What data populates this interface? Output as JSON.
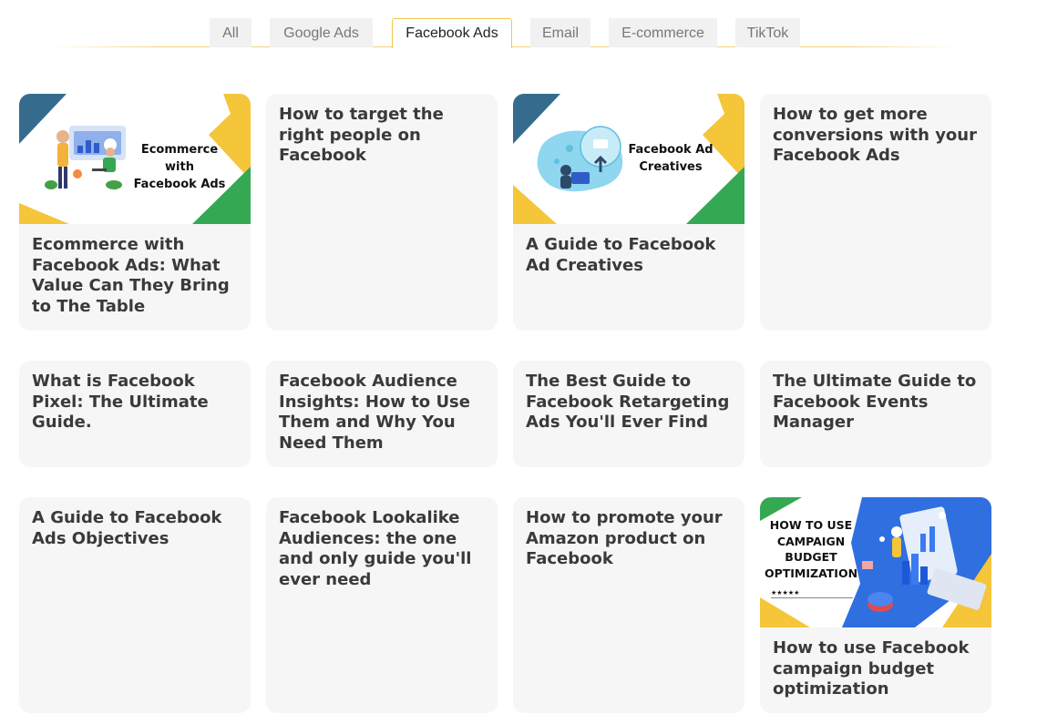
{
  "tabs": [
    {
      "label": "All"
    },
    {
      "label": "Google Ads"
    },
    {
      "label": "Facebook Ads",
      "active": true
    },
    {
      "label": "Email"
    },
    {
      "label": "E-commerce"
    },
    {
      "label": "TikTok"
    }
  ],
  "colors": {
    "accent": "#f0c64a",
    "card_bg": "#f6f6f6",
    "title_text": "#3a3a3a",
    "thumb_yellow": "#f5c53a",
    "thumb_green": "#34a853",
    "thumb_blue": "#356c8e"
  },
  "cards": [
    {
      "title": "Ecommerce with Facebook Ads: What Value Can They Bring to The Table",
      "thumbnail": {
        "line1": "Ecommerce with",
        "line2": "Facebook Ads",
        "illustration": "people-with-dashboard-illustration"
      }
    },
    {
      "title": "How to target the right people on Facebook"
    },
    {
      "title": "A Guide to Facebook Ad Creatives",
      "thumbnail": {
        "line1": "Facebook Ad",
        "line2": "Creatives",
        "illustration": "person-with-laptop-illustration"
      }
    },
    {
      "title": "How to get more conversions with your Facebook Ads"
    },
    {
      "title": "What is Facebook Pixel: The Ultimate Guide."
    },
    {
      "title": "Facebook Audience Insights: How to Use Them and Why You Need Them"
    },
    {
      "title": "The Best Guide to Facebook Retargeting Ads You'll Ever Find"
    },
    {
      "title": "The Ultimate Guide to Facebook Events Manager"
    },
    {
      "title": "A Guide to Facebook Ads Objectives"
    },
    {
      "title": "Facebook Lookalike Audiences: the one and only guide you'll ever need"
    },
    {
      "title": "How to promote your Amazon product on Facebook"
    },
    {
      "title": "How to use Facebook campaign budget optimization",
      "thumbnail": {
        "line1": "HOW TO USE",
        "line2": "CAMPAIGN",
        "line3": "BUDGET",
        "line4": "OPTIMIZATION",
        "illustration": "isometric-charts-illustration"
      }
    }
  ]
}
